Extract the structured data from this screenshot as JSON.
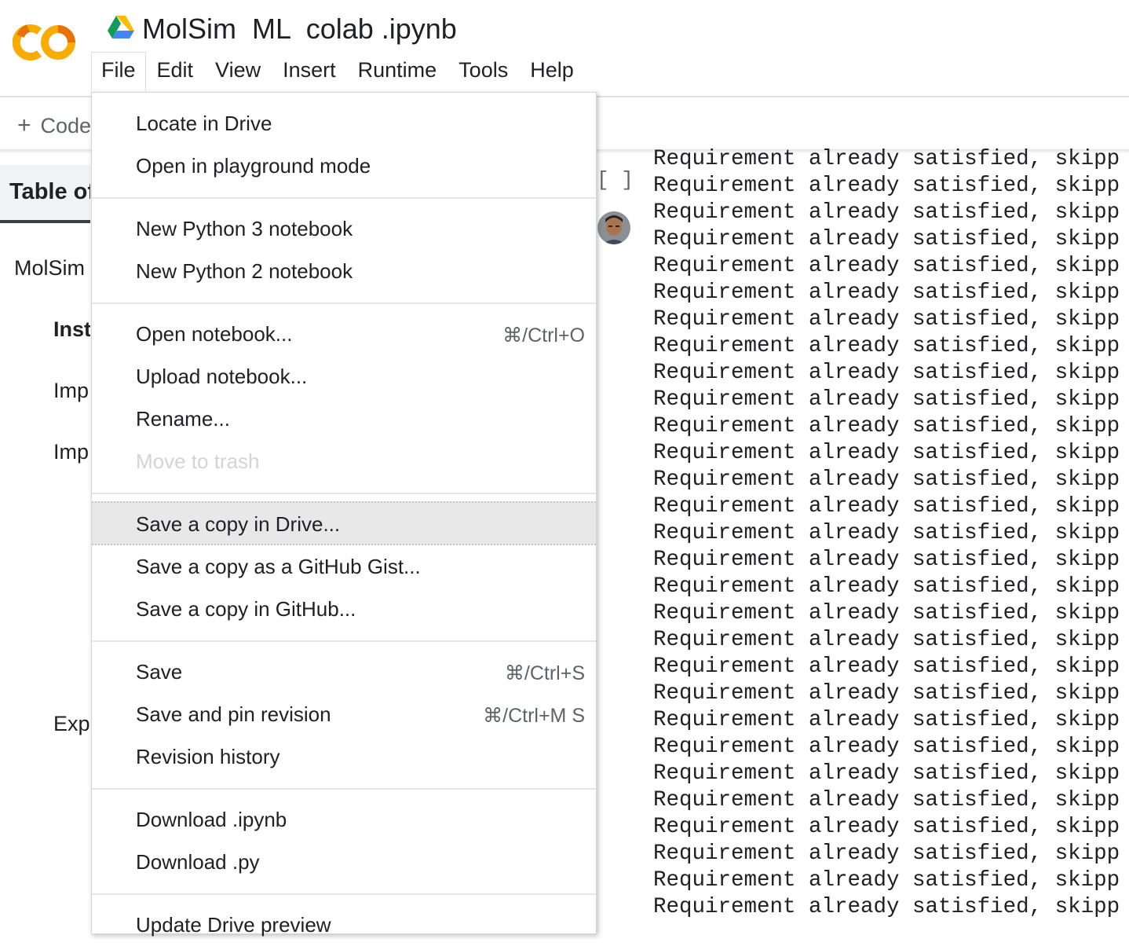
{
  "header": {
    "title": "MolSim  ML  colab .ipynb",
    "menu": [
      "File",
      "Edit",
      "View",
      "Insert",
      "Runtime",
      "Tools",
      "Help"
    ],
    "active_menu": "File"
  },
  "toolbar": {
    "add_code_label": "Code",
    "add_code_plus": "+"
  },
  "sidebar": {
    "toc_tab": "Table of contents",
    "entries": [
      "MolSim",
      "Inst",
      "Imp",
      "Imp",
      "Exp"
    ]
  },
  "cell": {
    "bracket": "[ ]"
  },
  "output": {
    "line": "Requirement already satisfied, skipp",
    "line_count": 29
  },
  "file_menu": {
    "items": [
      {
        "label": "Locate in Drive",
        "shortcut": ""
      },
      {
        "label": "Open in playground mode",
        "shortcut": ""
      },
      {
        "label": "New Python 3 notebook",
        "shortcut": ""
      },
      {
        "label": "New Python 2 notebook",
        "shortcut": ""
      },
      {
        "label": "Open notebook...",
        "shortcut": "⌘/Ctrl+O"
      },
      {
        "label": "Upload notebook...",
        "shortcut": ""
      },
      {
        "label": "Rename...",
        "shortcut": ""
      },
      {
        "label": "Move to trash",
        "shortcut": "",
        "disabled": true
      },
      {
        "label": "Save a copy in Drive...",
        "shortcut": "",
        "highlighted": true
      },
      {
        "label": "Save a copy as a GitHub Gist...",
        "shortcut": ""
      },
      {
        "label": "Save a copy in GitHub...",
        "shortcut": ""
      },
      {
        "label": "Save",
        "shortcut": "⌘/Ctrl+S"
      },
      {
        "label": "Save and pin revision",
        "shortcut": "⌘/Ctrl+M S"
      },
      {
        "label": "Revision history",
        "shortcut": ""
      },
      {
        "label": "Download .ipynb",
        "shortcut": ""
      },
      {
        "label": "Download .py",
        "shortcut": ""
      },
      {
        "label": "Update Drive preview",
        "shortcut": ""
      }
    ]
  },
  "colors": {
    "logo_orange": "#f9ab00",
    "logo_dark_orange": "#e8710a",
    "highlight": "#e8e8e8",
    "disabled_text": "#d4d4d4"
  },
  "icons": [
    "colab-logo-icon",
    "google-drive-icon",
    "plus-icon",
    "user-avatar"
  ]
}
